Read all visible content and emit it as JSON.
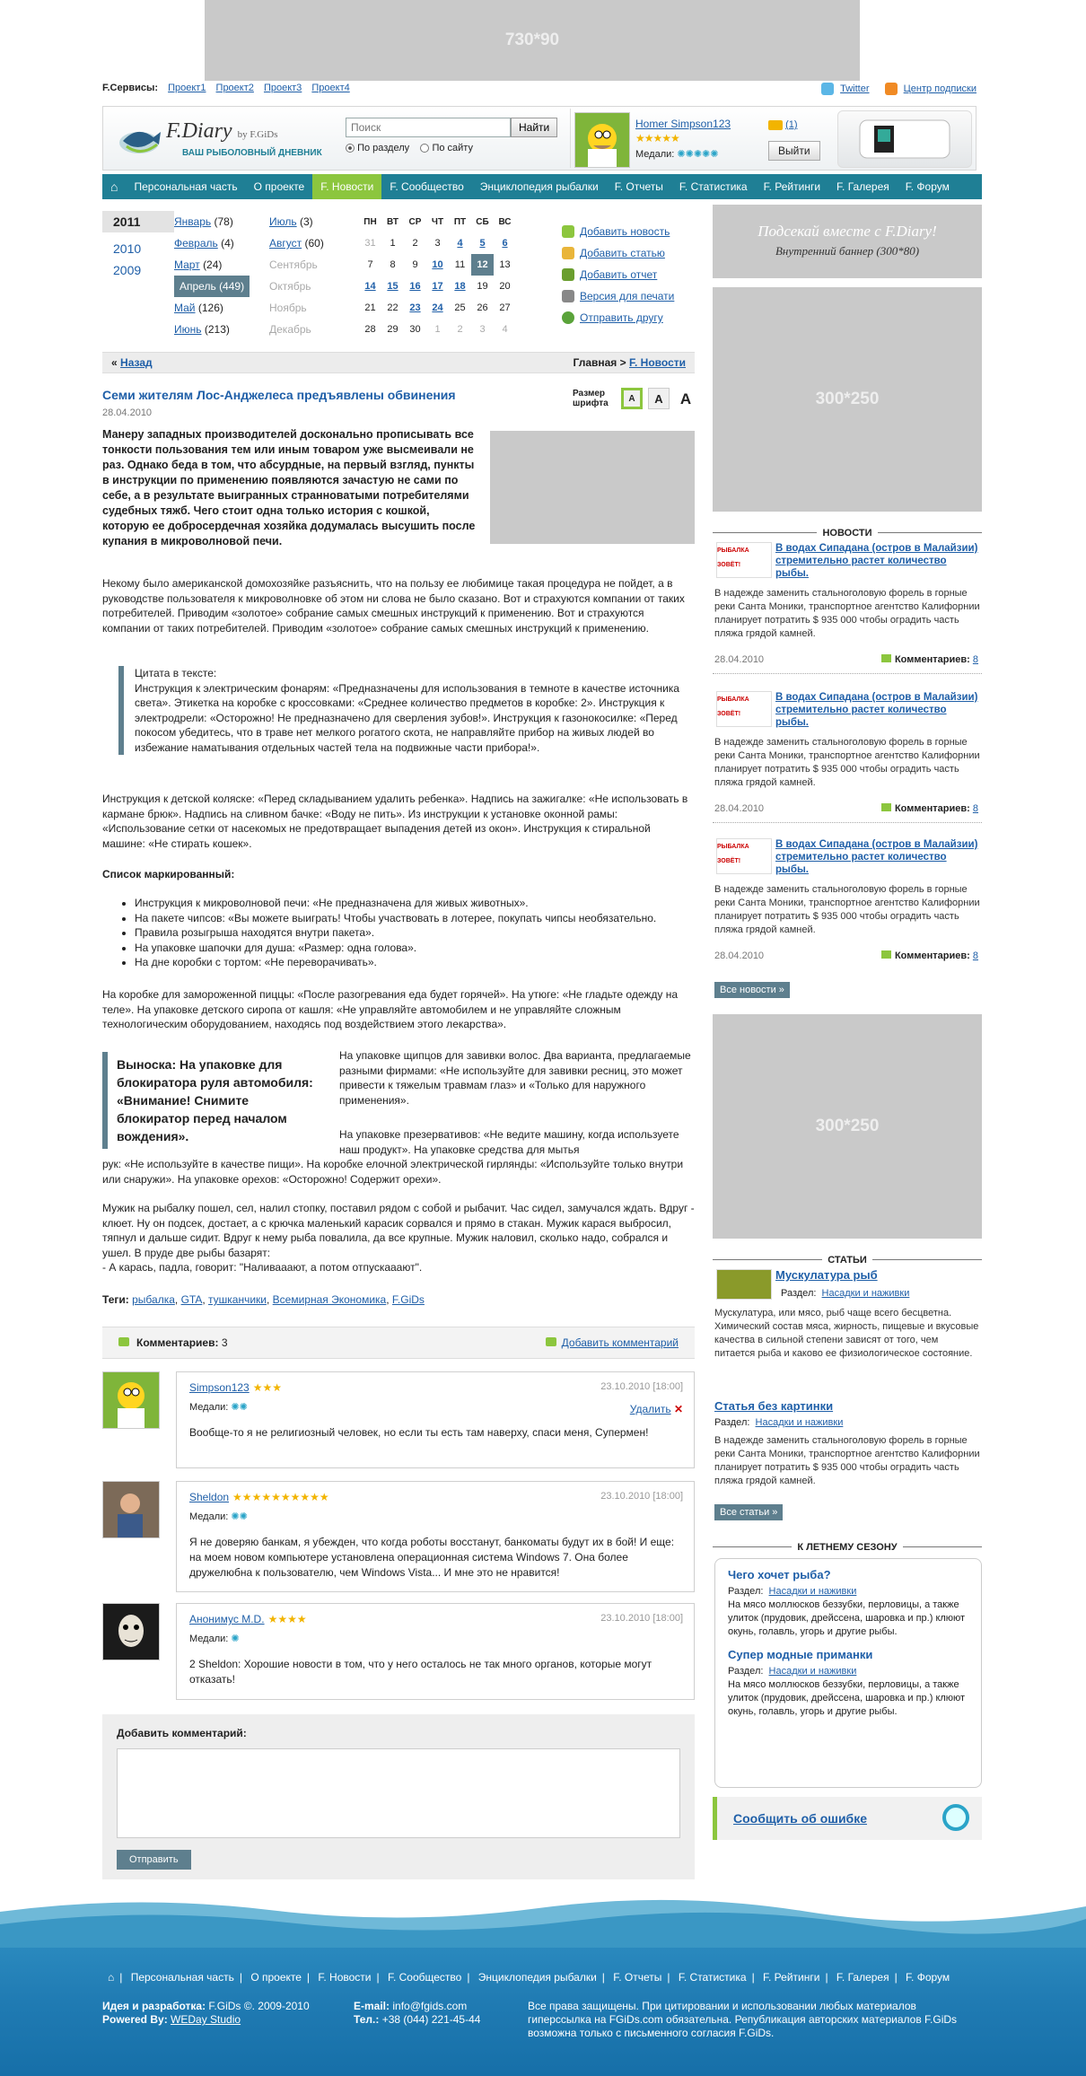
{
  "top_banner": "730*90",
  "topbar": {
    "label": "F.Сервисы:",
    "links": [
      "Проект1",
      "Проект2",
      "Проект3",
      "Проект4"
    ],
    "twitter": "Twitter",
    "subscribe": "Центр подписки"
  },
  "logo": {
    "title": "F.Diary",
    "by": "by F.GiDs",
    "subtitle": "ВАШ РЫБОЛОВНЫЙ ДНЕВНИК"
  },
  "search": {
    "placeholder": "Поиск",
    "button": "Найти",
    "opt1": "По разделу",
    "opt2": "По сайту"
  },
  "user": {
    "name": "Homer Simpson123",
    "stars": "★★★★★",
    "medals_label": "Медали:",
    "medals": "✺✺✺✺✺",
    "mail": "(1)",
    "logout": "Выйти"
  },
  "nav": [
    "Персональная часть",
    "О проекте",
    "F. Новости",
    "F. Сообщество",
    "Энциклопедия рыбалки",
    "F. Отчеты",
    "F. Статистика",
    "F. Рейтинги",
    "F. Галерея",
    "F. Форум"
  ],
  "archive": {
    "years": [
      "2011",
      "2010",
      "2009"
    ],
    "months_left": [
      {
        "name": "Январь",
        "count": "(78)"
      },
      {
        "name": "Февраль",
        "count": "(4)"
      },
      {
        "name": "Март",
        "count": "(24)"
      },
      {
        "name": "Апрель",
        "count": "(449)"
      },
      {
        "name": "Май",
        "count": "(126)"
      },
      {
        "name": "Июнь",
        "count": "(213)"
      }
    ],
    "months_right": [
      {
        "name": "Июль",
        "count": "(3)"
      },
      {
        "name": "Август",
        "count": "(60)"
      },
      {
        "name": "Сентябрь",
        "count": ""
      },
      {
        "name": "Октябрь",
        "count": ""
      },
      {
        "name": "Ноябрь",
        "count": ""
      },
      {
        "name": "Декабрь",
        "count": ""
      }
    ]
  },
  "calendar": {
    "headers": [
      "ПН",
      "ВТ",
      "СР",
      "ЧТ",
      "ПТ",
      "СБ",
      "ВС"
    ],
    "rows": [
      [
        "31",
        "1",
        "2",
        "3",
        "4",
        "5",
        "6"
      ],
      [
        "7",
        "8",
        "9",
        "10",
        "11",
        "12",
        "13"
      ],
      [
        "14",
        "15",
        "16",
        "17",
        "18",
        "19",
        "20"
      ],
      [
        "21",
        "22",
        "23",
        "24",
        "25",
        "26",
        "27"
      ],
      [
        "28",
        "29",
        "30",
        "1",
        "2",
        "3",
        "4"
      ]
    ]
  },
  "actions": [
    "Добавить новость",
    "Добавить статью",
    "Добавить отчет",
    "Версия для печати",
    "Отправить другу"
  ],
  "crumbs": {
    "back": "Назад",
    "home": "Главная",
    "sep": ">",
    "section": "F. Новости",
    "raquo": "«"
  },
  "article": {
    "title": "Семи жителям Лос-Анджелеса предъявлены обвинения",
    "date": "28.04.2010",
    "fontsize_label": "Размер шрифта",
    "font_a": "A",
    "lead": "Манеру западных производителей досконально прописывать все тонкости пользования тем или иным товаром уже высмеивали не раз. Однако беда в том, что абсурдные, на первый взгляд, пункты в инструкции по применению появляются зачастую не сами по себе, а в результате выигранных странноватыми потребителями судебных тяжб. Чего стоит одна только история с кошкой, которую ее добросердечная хозяйка додумалась высушить после купания в микроволновой печи.",
    "p1": "Некому было американской домохозяйке разъяснить, что на пользу ее любимице такая процедура не пойдет, а в руководстве пользователя к микроволновке об этом ни слова не было сказано. Вот и страхуются компании от таких потребителей. Приводим «золотое» собрание самых смешных инструкций к применению. Вот и страхуются компании от таких потребителей. Приводим «золотое» собрание самых смешных инструкций к применению.",
    "quote": "Цитата в тексте:\nИнструкция к электрическим фонарям: «Предназначены для использования в темноте в качестве источника света». Этикетка на коробке с кроссовками: «Среднее количество предметов в коробке: 2». Инструкция к электродрели: «Осторожно! Не предназначено для сверления зубов!». Инструкция к газонокосилке: «Перед покосом убедитесь, что в траве нет мелкого рогатого скота, не направляйте прибор на живых людей во избежание наматывания отдельных частей тела на подвижные части прибора!».",
    "p2": "Инструкция к детской коляске: «Перед складыванием удалить ребенка». Надпись на зажигалке: «Не использовать в кармане брюк». Надпись на сливном бачке: «Воду не пить». Из инструкции к установке оконной рамы: «Использование сетки от насекомых не предотвращает выпадения детей из окон». Инструкция к стиральной машине: «Не стирать кошек».",
    "list_title": "Список маркированный:",
    "list": [
      "Инструкция к микроволновой печи: «Не предназначена для живых животных».",
      "На пакете чипсов: «Вы можете выиграть! Чтобы участвовать в лотерее, покупать чипсы необязательно.",
      "Правила розыгрыша находятся внутри пакета».",
      "На упаковке шапочки для душа: «Размер: одна голова».",
      "На дне коробки с тортом: «Не переворачивать»."
    ],
    "p3": "На коробке для замороженной пиццы: «После разогревания еда будет горячей». На утюге: «Не гладьте одежду на теле». На упаковке детского сиропа от кашля: «Не управляйте автомобилем и не управляйте сложным технологическим оборудованием, находясь под воздействием этого лекарства».",
    "callout": "Выноска: На упаковке для блокиратора руля автомобиля: «Внимание! Снимите блокиратор перед началом вождения».",
    "p4": "На упаковке щипцов для завивки волос. Два варианта, предлагаемые разными фирмами: «Не используйте для завивки ресниц, это может привести к тяжелым травмам глаз» и «Только для наружного применения».",
    "p5a": "На упаковке презервативов: «Не ведите машину, когда используете наш продукт». На упаковке средства для мытья",
    "p5b": "рук: «Не используйте в качестве пищи». На коробке елочной электрической гирлянды: «Используйте только внутри или снаружи». На упаковке орехов: «Осторожно! Содержит орехи».",
    "p6": "Мужик на рыбалку пошел, сел, налил стопку, поставил рядом с собой и рыбачит. Час сидел, замучался ждать. Вдруг - клюет. Ну он подсек, достает, а с крючка маленький карасик сорвался и прямо в стакан. Мужик карася выбросил, тяпнул и дальше сидит. Вдруг к нему рыба повалила, да все крупные. Мужик наловил, сколько надо, собрался и ушел. В пруде две рыбы базарят:\n- А карась, падла, говорит: \"Наливааают, а потом отпускааают\".",
    "tags_label": "Теги:",
    "tags": [
      "рыбалка",
      "GTA",
      "тушканчики",
      "Всемирная Экономика",
      "F.GiDs"
    ]
  },
  "comments": {
    "label": "Комментариев:",
    "count": "3",
    "add_link": "Добавить комментарий",
    "medals_label": "Медали:",
    "delete": "Удалить",
    "items": [
      {
        "name": "Simpson123",
        "stars": "★★★",
        "date": "23.10.2010 [18:00]",
        "medals": "✺✺",
        "text": "Вообще-то я не религиозный человек, но если ты есть там наверху, спаси меня, Супермен!"
      },
      {
        "name": "Sheldon",
        "stars": "★★★★★★★★★★",
        "date": "23.10.2010 [18:00]",
        "medals": "✺✺",
        "text": "Я не доверяю банкам, я убежден, что когда роботы восстанут, банкоматы будут их в бой! И еще: на моем новом компьютере установлена операционная система Windows 7. Она более дружелюбна к пользователю, чем Windows Vista... И мне это не нравится!"
      },
      {
        "name": "Анонимус M.D.",
        "stars": "★★★★",
        "date": "23.10.2010 [18:00]",
        "medals": "✺",
        "text": "2 Sheldon: Хорошие новости в том, что у него осталось не так много органов, которые могут отказать!"
      }
    ],
    "form_title": "Добавить комментарий:",
    "submit": "Отправить"
  },
  "sidebar": {
    "inner_banner_t1": "Подсекай вместе с F.Diary!",
    "inner_banner_t2": "Внутренний баннер (300*80)",
    "banner1": "300*250",
    "news_head": "НОВОСТИ",
    "news": [
      {
        "thumb": "РЫБАЛКА ЗОВЁТ!",
        "title": "В водах Сипадана (остров в Малайзии) стремительно растет количество рыбы.",
        "body": "В надежде заменить стальноголовую форель в горные реки Санта Моники, транспортное агентство Калифорнии планирует потратить $ 935 000 чтобы оградить часть пляжа грядой камней.",
        "date": "28.04.2010",
        "comments_label": "Комментариев:",
        "comments": "8"
      },
      {
        "thumb": "РЫБАЛКА ЗОВЁТ!",
        "title": "В водах Сипадана (остров в Малайзии) стремительно растет количество рыбы.",
        "body": "В надежде заменить стальноголовую форель в горные реки Санта Моники, транспортное агентство Калифорнии планирует потратить $ 935 000 чтобы оградить часть пляжа грядой камней.",
        "date": "28.04.2010",
        "comments_label": "Комментариев:",
        "comments": "8"
      },
      {
        "thumb": "РЫБАЛКА ЗОВЁТ!",
        "title": "В водах Сипадана (остров в Малайзии) стремительно растет количество рыбы.",
        "body": "В надежде заменить стальноголовую форель в горные реки Санта Моники, транспортное агентство Калифорнии планирует потратить $ 935 000 чтобы оградить часть пляжа грядой камней.",
        "date": "28.04.2010",
        "comments_label": "Комментариев:",
        "comments": "8"
      }
    ],
    "all_news": "Все новости",
    "banner2": "300*250",
    "articles_head": "СТАТЬИ",
    "articles": [
      {
        "title": "Мускулатура рыб",
        "section_label": "Раздел:",
        "section": "Насадки и наживки",
        "body": "Мускулатура, или мясо, рыб чаще всего бесцветна. Химический состав мяса, жирность, пищевые и вкусовые качества в сильной степени зависят от того, чем питается рыба и каково ее физиологическое состояние."
      },
      {
        "title": "Статья без картинки",
        "section_label": "Раздел:",
        "section": "Насадки и наживки",
        "body": "В надежде заменить стальноголовую форель в горные реки Санта Моники, транспортное агентство Калифорнии планирует потратить $ 935 000 чтобы оградить часть пляжа грядой камней."
      }
    ],
    "all_articles": "Все статьи",
    "summer_head": "К ЛЕТНЕМУ СЕЗОНУ",
    "summer": [
      {
        "title": "Чего хочет рыба?",
        "section_label": "Раздел:",
        "section": "Насадки и наживки",
        "body": "На мясо моллюсков беззубки, перловицы, а также улиток (прудовик, дрейссена, шаровка и пр.) клюют окунь, голавль, угорь и другие рыбы."
      },
      {
        "title": "Супер модные приманки",
        "section_label": "Раздел:",
        "section": "Насадки и наживки",
        "body": "На мясо моллюсков беззубки, перловицы, а также улиток (прудовик, дрейссена, шаровка и пр.) клюют окунь, голавль, угорь и другие рыбы."
      }
    ],
    "report": "Сообщить об ошибке"
  },
  "footer": {
    "nav": [
      "Персональная часть",
      "О проекте",
      "F. Новости",
      "F. Сообщество",
      "Энциклопедия рыбалки",
      "F. Отчеты",
      "F. Статистика",
      "F. Рейтинги",
      "F. Галерея",
      "F. Форум"
    ],
    "idea_label": "Идея и разработка:",
    "idea": "F.GiDs ©. 2009-2010",
    "powered_label": "Powered By:",
    "powered": "WEDay Studio",
    "email_label": "E-mail:",
    "email": "info@fgids.com",
    "tel_label": "Тел.:",
    "tel": "+38 (044) 221-45-44",
    "rights": "Все права защищены. При цитировании и использовании любых материалов гиперссылка на FGiDs.com обязательна. Републикация авторских материалов F.GiDs возможна только с письменного согласия F.GiDs."
  },
  "colors": {
    "nav": "#1f7f95",
    "accent": "#8cc63e",
    "link": "#1f5fa8",
    "dark": "#5e7f8e"
  }
}
